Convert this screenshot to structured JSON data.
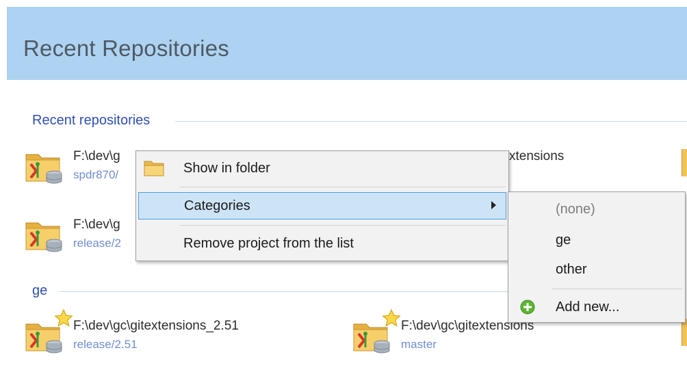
{
  "header": {
    "title": "Recent Repositories"
  },
  "sections": {
    "recent": {
      "label": "Recent repositories"
    },
    "ge": {
      "label": "ge"
    }
  },
  "repos": {
    "r1": {
      "path": "F:\\dev\\g",
      "path_right": "xtensions",
      "branch": "spdr870/"
    },
    "r2": {
      "path": "F:\\dev\\g",
      "branch": "release/2"
    },
    "r3": {
      "path": "F:\\dev\\gc\\gitextensions_2.51",
      "branch": "release/2.51"
    },
    "r4": {
      "path": "F:\\dev\\gc\\gitextensions",
      "branch": "master"
    }
  },
  "context_menu": {
    "show_in_folder": "Show in folder",
    "categories": "Categories",
    "remove": "Remove project from the list"
  },
  "categories_menu": {
    "none": "(none)",
    "ge": "ge",
    "other": "other",
    "add_new": "Add new..."
  },
  "colors": {
    "header_bg": "#aed3f2",
    "section_label": "#2f4fb1",
    "branch_text": "#6f8ed0",
    "highlight_bg": "#cde4f7",
    "highlight_border": "#4b9ce0"
  },
  "icons": {
    "repo": "repository-folder-icon",
    "favorite": "star-icon",
    "folder": "folder-icon",
    "add": "add-plus-icon"
  }
}
